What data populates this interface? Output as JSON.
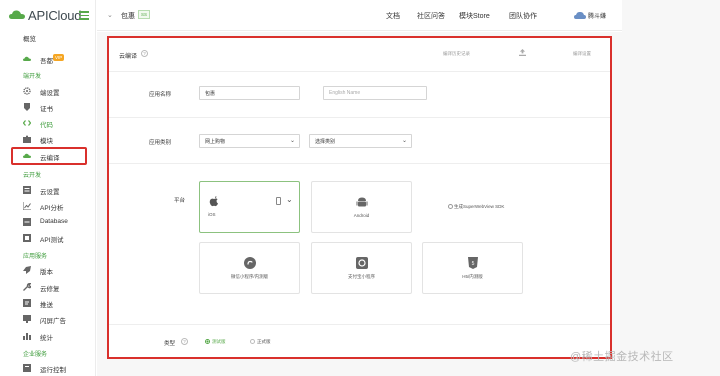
{
  "brand": {
    "name": "APICloud",
    "accent": "#57a94a",
    "highlight": "#d9302c"
  },
  "sidebar": {
    "overview": "概览",
    "app_name": "吾都",
    "app_badge": "VIP",
    "sections": {
      "develop": "端开发",
      "cloud": "云开发",
      "services": "应用服务",
      "enterprise": "企业服务"
    },
    "items": [
      {
        "label": "端设置",
        "icon": "gear-icon"
      },
      {
        "label": "证书",
        "icon": "certificate-icon"
      },
      {
        "label": "代码",
        "icon": "code-icon"
      },
      {
        "label": "模块",
        "icon": "puzzle-icon"
      },
      {
        "label": "云编译",
        "icon": "cloud-icon"
      },
      {
        "label": "云设置",
        "icon": "list-icon"
      },
      {
        "label": "API分析",
        "icon": "chart-icon"
      },
      {
        "label": "Database",
        "icon": "database-icon"
      },
      {
        "label": "API测试",
        "icon": "test-icon"
      },
      {
        "label": "版本",
        "icon": "rocket-icon"
      },
      {
        "label": "云修复",
        "icon": "wrench-icon"
      },
      {
        "label": "推送",
        "icon": "push-icon"
      },
      {
        "label": "闪屏广告",
        "icon": "ad-icon"
      },
      {
        "label": "统计",
        "icon": "stats-icon"
      },
      {
        "label": "运行控制",
        "icon": "control-icon"
      }
    ]
  },
  "header": {
    "app": "包惠",
    "tag": "SS",
    "nav": [
      "文档",
      "社区问答",
      "模块Store",
      "团队协作"
    ],
    "user": "腾斗嫌"
  },
  "panel": {
    "title": "云编译",
    "history": "编译历史记录",
    "settings": "编译设置",
    "name_label": "应用名称",
    "name_value": "包惠",
    "english_placeholder": "English Name",
    "category_label": "应用类别",
    "category_value": "网上购物",
    "subcategory_value": "选择类别",
    "platform_label": "平台",
    "platforms": [
      "iOS",
      "Android",
      "微信小程序/内测版",
      "支付宝小程序",
      "H5/内测版"
    ],
    "sdk_label": "生成SuperWebView SDK",
    "type_label": "类型",
    "types": [
      "测试版",
      "正式版"
    ]
  },
  "watermark": "@稀土掘金技术社区"
}
